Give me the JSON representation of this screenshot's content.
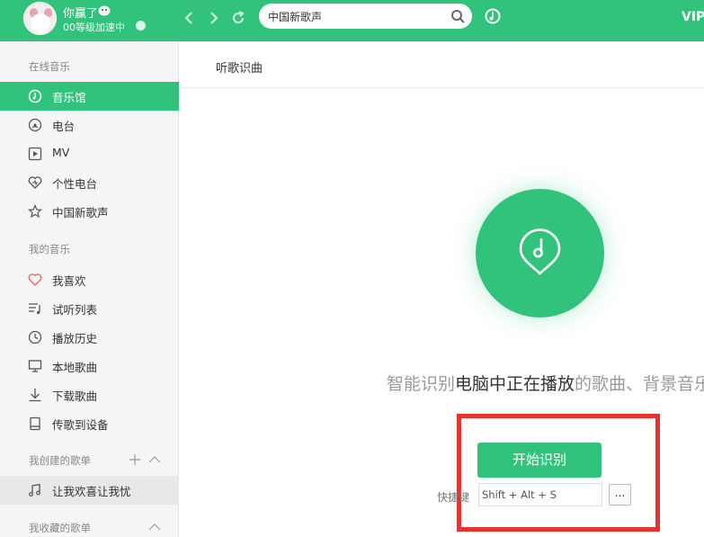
{
  "header": {
    "username": "你赢了",
    "level": "00等级加速中",
    "search": {
      "value": "中国新歌声",
      "placeholder": ""
    },
    "vip_label": "VIP"
  },
  "sidebar": {
    "online_title": "在线音乐",
    "online_items": [
      {
        "label": "音乐馆",
        "icon": "music-hall-icon",
        "active": true
      },
      {
        "label": "电台",
        "icon": "radio-icon"
      },
      {
        "label": "MV",
        "icon": "mv-icon"
      },
      {
        "label": "个性电台",
        "icon": "heart-radio-icon"
      },
      {
        "label": "中国新歌声",
        "icon": "star-icon"
      }
    ],
    "my_music_title": "我的音乐",
    "my_items": [
      {
        "label": "我喜欢",
        "icon": "heart-icon"
      },
      {
        "label": "试听列表",
        "icon": "playlist-icon"
      },
      {
        "label": "播放历史",
        "icon": "clock-icon"
      },
      {
        "label": "本地歌曲",
        "icon": "monitor-icon"
      },
      {
        "label": "下载歌曲",
        "icon": "download-icon"
      },
      {
        "label": "传歌到设备",
        "icon": "device-icon"
      }
    ],
    "created_title": "我创建的歌单",
    "created_items": [
      {
        "label": "让我欢喜让我忧",
        "icon": "music-note-icon"
      }
    ],
    "collected_title": "我收藏的歌单"
  },
  "main": {
    "tab_title": "听歌识曲",
    "description": {
      "part1": "智能识别",
      "part2": "电脑中正在播放",
      "part3": "的歌曲、背景音乐"
    },
    "start_button": "开始识别",
    "shortcut_label": "快捷键",
    "shortcut_value": "Shift + Alt + S",
    "more_button": "..."
  },
  "colors": {
    "brand_green": "#31c27c",
    "highlight_red": "#e63332"
  }
}
